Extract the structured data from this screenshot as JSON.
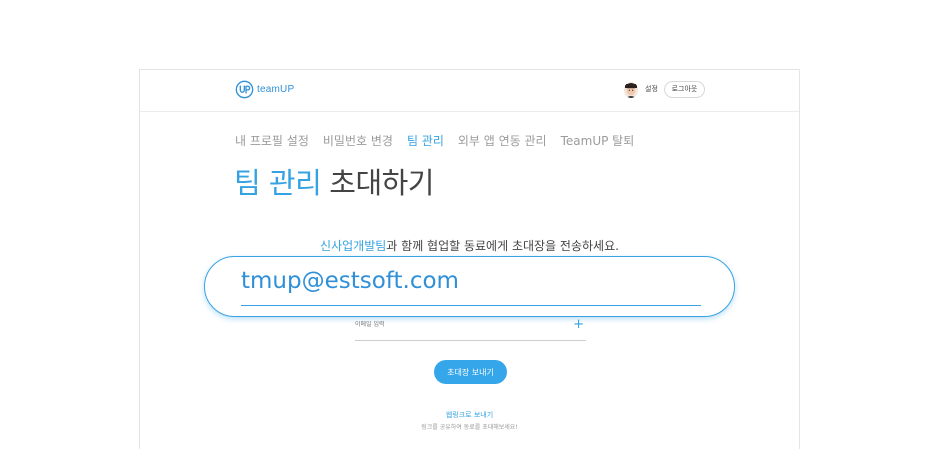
{
  "header": {
    "brand": "teamUP",
    "settings_label": "설정",
    "logout_label": "로그아웃"
  },
  "subnav": {
    "items": [
      "내 프로필 설정",
      "비밀번호 변경",
      "팀 관리",
      "외부 앱 연동 관리",
      "TeamUP 탈퇴"
    ],
    "active_index": 2
  },
  "title": {
    "accent": "팀 관리",
    "main": "초대하기"
  },
  "instruction": {
    "team": "신사업개발팀",
    "text": "과 함께 협업할 동료에게 초대장을 전송하세요."
  },
  "email_input": {
    "placeholder": "이메일 입력",
    "add_icon": "plus-icon"
  },
  "zoom_input": {
    "value": "tmup@estsoft.com"
  },
  "send_button": "초대장 보내기",
  "link_send": "웹링크로 보내기",
  "link_desc": "링크를 공유하여 동료를 초대해보세요!",
  "colors": {
    "accent": "#35a3e2",
    "button": "#36a6ea",
    "text": "#444444",
    "muted": "#9b9b9b"
  }
}
